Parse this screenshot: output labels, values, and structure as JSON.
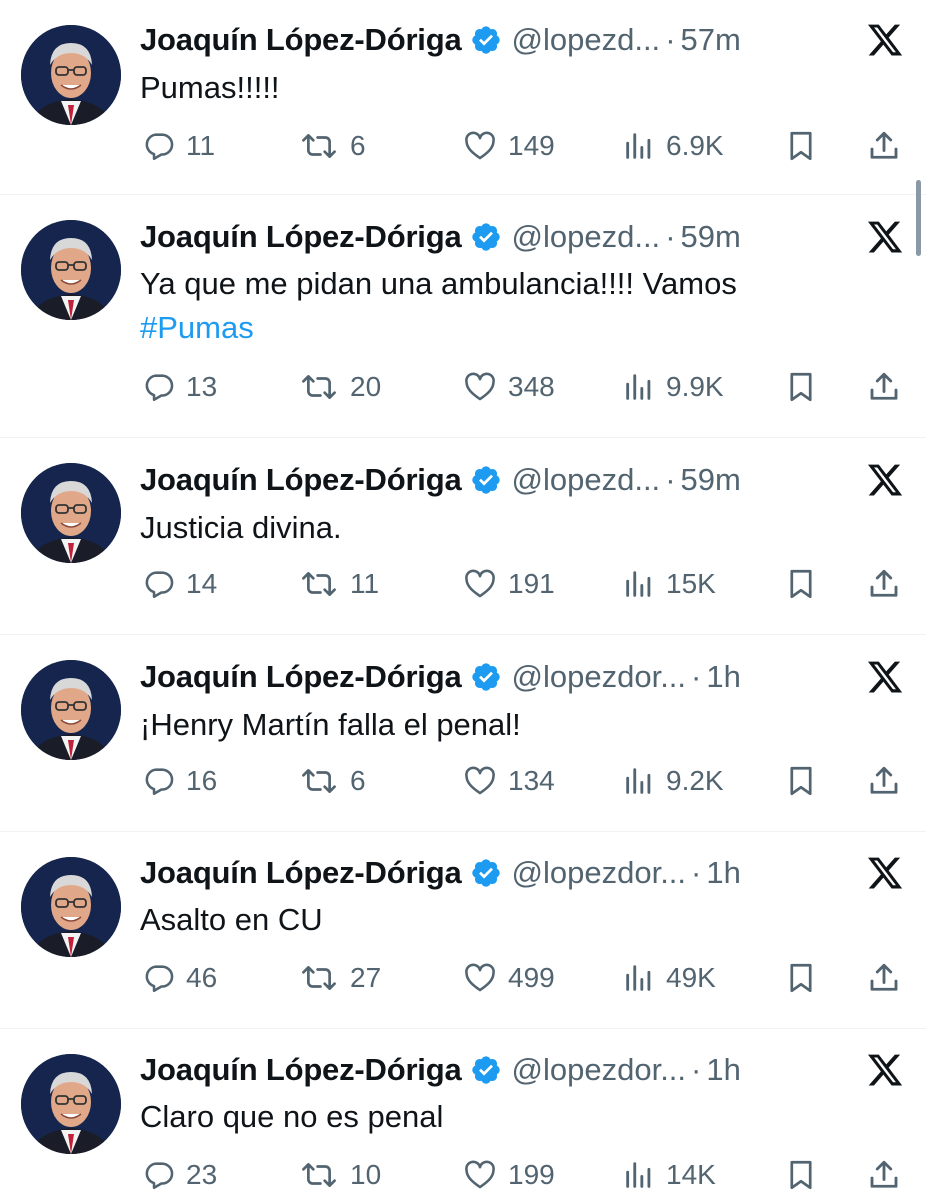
{
  "author": {
    "name": "Joaquín López-Dóriga",
    "verified": true
  },
  "colors": {
    "text": "#0f1419",
    "secondary": "#536471",
    "accent": "#1d9bf0",
    "divider": "#eff3f4"
  },
  "icons": {
    "reply": "reply-icon",
    "retweet": "retweet-icon",
    "like": "heart-icon",
    "views": "views-icon",
    "bookmark": "bookmark-icon",
    "share": "share-icon",
    "platform": "x-logo-icon",
    "verified": "verified-badge-icon"
  },
  "tweets": [
    {
      "handle": "@lopezd...",
      "time": "57m",
      "text": "Pumas!!!!!",
      "text_line2": "",
      "hashtag": "",
      "replies": "11",
      "retweets": "6",
      "likes": "149",
      "views": "6.9K"
    },
    {
      "handle": "@lopezd...",
      "time": "59m",
      "text": "Ya que me pidan una ambulancia!!!! Vamos",
      "text_line2": "",
      "hashtag": "#Pumas",
      "replies": "13",
      "retweets": "20",
      "likes": "348",
      "views": "9.9K"
    },
    {
      "handle": "@lopezd...",
      "time": "59m",
      "text": "Justicia divina.",
      "text_line2": "",
      "hashtag": "",
      "replies": "14",
      "retweets": "11",
      "likes": "191",
      "views": "15K"
    },
    {
      "handle": "@lopezdor...",
      "time": "1h",
      "text": "¡Henry Martín falla el penal!",
      "text_line2": "",
      "hashtag": "",
      "replies": "16",
      "retweets": "6",
      "likes": "134",
      "views": "9.2K"
    },
    {
      "handle": "@lopezdor...",
      "time": "1h",
      "text": "Asalto en CU",
      "text_line2": "",
      "hashtag": "",
      "replies": "46",
      "retweets": "27",
      "likes": "499",
      "views": "49K"
    },
    {
      "handle": "@lopezdor...",
      "time": "1h",
      "text": "Claro que no es penal",
      "text_line2": "",
      "hashtag": "",
      "replies": "23",
      "retweets": "10",
      "likes": "199",
      "views": "14K"
    }
  ]
}
